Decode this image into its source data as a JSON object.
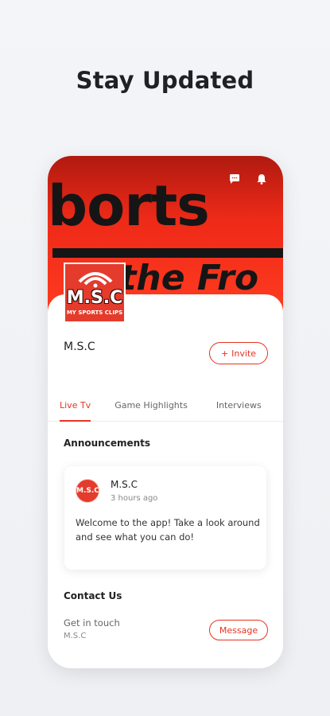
{
  "headline": "Stay Updated",
  "cover": {
    "text_line1": "borts",
    "text_line2": "i the Fro"
  },
  "header_icons": [
    "chat-icon",
    "bell-icon"
  ],
  "logo": {
    "title": "M.S.C",
    "subtitle": "MY SPORTS CLIPS"
  },
  "site": {
    "name": "M.S.C",
    "invite_label": "Invite",
    "invite_icon": "+"
  },
  "tabs": [
    {
      "label": "Live Tv",
      "active": true
    },
    {
      "label": "Game Highlights",
      "active": false
    },
    {
      "label": "Interviews",
      "active": false
    }
  ],
  "announcements": {
    "title": "Announcements",
    "post": {
      "author": "M.S.C",
      "time": "3 hours ago",
      "avatar_text": "M.S.C",
      "body": "Welcome to the app! Take a look around and see what you can do!"
    }
  },
  "contact": {
    "title": "Contact Us",
    "prompt": "Get in touch",
    "name": "M.S.C",
    "message_label": "Message"
  },
  "colors": {
    "accent": "#e5341f",
    "cover": "#ee2a18",
    "background": "#f1f3f6"
  }
}
